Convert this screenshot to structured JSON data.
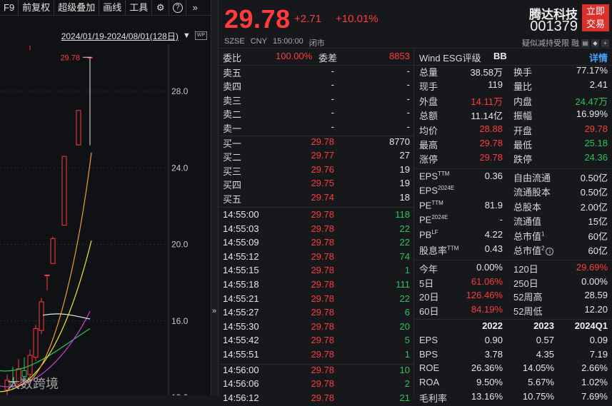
{
  "toolbar": {
    "items": [
      "F9",
      "前复权",
      "超级叠加",
      "画线",
      "工具"
    ],
    "icons": [
      "gear-icon",
      "help-icon",
      "more-icon"
    ],
    "icon_glyphs": [
      "⚙",
      "?",
      "»"
    ]
  },
  "range": {
    "text": "2024/01/19-2024/08/01(128日)",
    "badge": "WP"
  },
  "chart": {
    "y_ticks": [
      "28.0",
      "24.0",
      "20.0",
      "16.0",
      "12.0"
    ],
    "high_label": "29.78",
    "watermark": "大数跨境"
  },
  "chart_data": {
    "type": "candlestick",
    "ylim": [
      12.0,
      30.0
    ],
    "y_ticks": [
      28.0,
      24.0,
      20.0,
      16.0,
      12.0
    ],
    "candles": [
      {
        "o": 12.4,
        "h": 13.2,
        "l": 12.1,
        "c": 12.9,
        "dir": "up"
      },
      {
        "o": 12.8,
        "h": 13.6,
        "l": 12.4,
        "c": 12.6,
        "dir": "down"
      },
      {
        "o": 12.7,
        "h": 14.0,
        "l": 12.5,
        "c": 13.5,
        "dir": "up"
      },
      {
        "o": 13.4,
        "h": 14.1,
        "l": 12.9,
        "c": 13.1,
        "dir": "down"
      },
      {
        "o": 13.2,
        "h": 14.5,
        "l": 12.8,
        "c": 14.2,
        "dir": "up"
      },
      {
        "o": 14.1,
        "h": 15.8,
        "l": 13.9,
        "c": 15.6,
        "dir": "up"
      },
      {
        "o": 15.5,
        "h": 17.2,
        "l": 15.3,
        "c": 17.0,
        "dir": "up"
      },
      {
        "o": 18.4,
        "h": 18.4,
        "l": 17.6,
        "c": 18.4,
        "dir": "up"
      },
      {
        "o": 19.0,
        "h": 20.4,
        "l": 19.0,
        "c": 20.3,
        "dir": "up"
      },
      {
        "o": 21.0,
        "h": 24.6,
        "l": 21.0,
        "c": 24.6,
        "dir": "up"
      },
      {
        "o": 25.2,
        "h": 27.0,
        "l": 25.2,
        "c": 27.0,
        "dir": "up"
      },
      {
        "o": 29.78,
        "h": 29.78,
        "l": 25.18,
        "c": 29.78,
        "dir": "up"
      }
    ],
    "annotation_high": 29.78
  },
  "header": {
    "price": "29.78",
    "change": "+2.71",
    "change_pct": "+10.01%",
    "exchange": "SZSE",
    "currency": "CNY",
    "time": "15:00:00",
    "status": "闭市",
    "name": "腾达科技",
    "code": "001379",
    "trade_button": [
      "立即",
      "交易"
    ],
    "tags_text": "疑似减持受限",
    "tag_glyph": "融"
  },
  "orderbook": {
    "ratio_label": "委比",
    "ratio_value": "100.00%",
    "diff_label": "委差",
    "diff_value": "8853",
    "asks": [
      {
        "label": "卖五",
        "price": "-",
        "vol": "-"
      },
      {
        "label": "卖四",
        "price": "-",
        "vol": "-"
      },
      {
        "label": "卖三",
        "price": "-",
        "vol": "-"
      },
      {
        "label": "卖二",
        "price": "-",
        "vol": "-"
      },
      {
        "label": "卖一",
        "price": "-",
        "vol": "-"
      }
    ],
    "bids": [
      {
        "label": "买一",
        "price": "29.78",
        "vol": "8770"
      },
      {
        "label": "买二",
        "price": "29.77",
        "vol": "27"
      },
      {
        "label": "买三",
        "price": "29.76",
        "vol": "19"
      },
      {
        "label": "买四",
        "price": "29.75",
        "vol": "19"
      },
      {
        "label": "买五",
        "price": "29.74",
        "vol": "18"
      }
    ]
  },
  "ticks": [
    {
      "time": "14:55:00",
      "price": "29.78",
      "vol": "118"
    },
    {
      "time": "14:55:03",
      "price": "29.78",
      "vol": "22"
    },
    {
      "time": "14:55:09",
      "price": "29.78",
      "vol": "22"
    },
    {
      "time": "14:55:12",
      "price": "29.78",
      "vol": "74"
    },
    {
      "time": "14:55:15",
      "price": "29.78",
      "vol": "1"
    },
    {
      "time": "14:55:18",
      "price": "29.78",
      "vol": "111"
    },
    {
      "time": "14:55:21",
      "price": "29.78",
      "vol": "22"
    },
    {
      "time": "14:55:27",
      "price": "29.78",
      "vol": "6"
    },
    {
      "time": "14:55:30",
      "price": "29.78",
      "vol": "20"
    },
    {
      "time": "14:55:42",
      "price": "29.78",
      "vol": "5"
    },
    {
      "time": "14:55:51",
      "price": "29.78",
      "vol": "1"
    },
    {
      "time": "14:56:00",
      "price": "29.78",
      "vol": "10"
    },
    {
      "time": "14:56:06",
      "price": "29.78",
      "vol": "2"
    },
    {
      "time": "14:56:12",
      "price": "29.78",
      "vol": "21"
    }
  ],
  "stats": {
    "wind_label": "Wind ESG评级",
    "wind_value": "BB",
    "detail": "详情",
    "rows": [
      {
        "l1": "总量",
        "v1": "38.58万",
        "c1": "white",
        "l2": "换手",
        "v2": "77.17%",
        "c2": "white"
      },
      {
        "l1": "现手",
        "v1": "119",
        "c1": "white",
        "l2": "量比",
        "v2": "2.41",
        "c2": "white"
      },
      {
        "l1": "外盘",
        "v1": "14.11万",
        "c1": "red",
        "l2": "内盘",
        "v2": "24.47万",
        "c2": "green"
      },
      {
        "l1": "总额",
        "v1": "11.14亿",
        "c1": "white",
        "l2": "振幅",
        "v2": "16.99%",
        "c2": "white"
      },
      {
        "l1": "均价",
        "v1": "28.88",
        "c1": "red",
        "l2": "开盘",
        "v2": "29.78",
        "c2": "red"
      },
      {
        "l1": "最高",
        "v1": "29.78",
        "c1": "red",
        "l2": "最低",
        "v2": "25.18",
        "c2": "green"
      },
      {
        "l1": "涨停",
        "v1": "29.78",
        "c1": "red",
        "l2": "跌停",
        "v2": "24.36",
        "c2": "green"
      }
    ],
    "val_rows": [
      {
        "l1": "EPS",
        "s1": "TTM",
        "v1": "0.36",
        "l2": "自由流通",
        "s2": "",
        "v2": "0.50亿"
      },
      {
        "l1": "EPS",
        "s1": "2024E",
        "v1": "",
        "l2": "流通股本",
        "s2": "",
        "v2": "0.50亿"
      },
      {
        "l1": "PE",
        "s1": "TTM",
        "v1": "81.9",
        "l2": "总股本",
        "s2": "",
        "v2": "2.00亿"
      },
      {
        "l1": "PE",
        "s1": "2024E",
        "v1": "-",
        "l2": "流通值",
        "s2": "",
        "v2": "15亿"
      },
      {
        "l1": "PB",
        "s1": "LF",
        "v1": "4.22",
        "l2": "总市值",
        "s2": "1",
        "v2": "60亿"
      },
      {
        "l1": "股息率",
        "s1": "TTM",
        "v1": "0.43",
        "l2": "总市值",
        "s2": "2",
        "v2": "60亿"
      }
    ],
    "perf_rows": [
      {
        "l1": "今年",
        "v1": "0.00%",
        "c1": "white",
        "l2": "120日",
        "v2": "29.69%",
        "c2": "red"
      },
      {
        "l1": "5日",
        "v1": "61.06%",
        "c1": "red",
        "l2": "250日",
        "v2": "0.00%",
        "c2": "white"
      },
      {
        "l1": "20日",
        "v1": "126.46%",
        "c1": "red",
        "l2": "52周高",
        "v2": "28.59",
        "c2": "white"
      },
      {
        "l1": "60日",
        "v1": "84.19%",
        "c1": "red",
        "l2": "52周低",
        "v2": "12.20",
        "c2": "white"
      }
    ],
    "fin_header": [
      "2022",
      "2023",
      "2024Q1"
    ],
    "fin_rows": [
      {
        "label": "EPS",
        "vals": [
          "0.90",
          "0.57",
          "0.09"
        ]
      },
      {
        "label": "BPS",
        "vals": [
          "3.78",
          "4.35",
          "7.19"
        ]
      },
      {
        "label": "ROE",
        "vals": [
          "26.36%",
          "14.05%",
          "2.66%"
        ]
      },
      {
        "label": "ROA",
        "vals": [
          "9.50%",
          "5.67%",
          "1.02%"
        ]
      },
      {
        "label": "毛利率",
        "vals": [
          "13.16%",
          "10.75%",
          "7.69%"
        ]
      }
    ]
  }
}
